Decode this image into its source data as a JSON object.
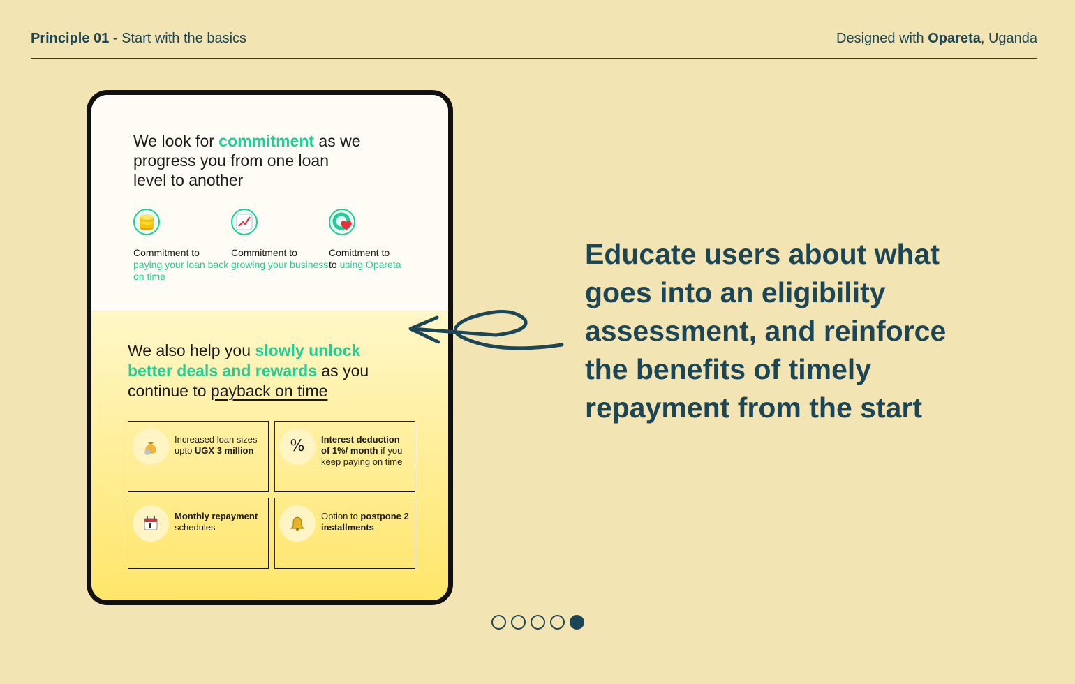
{
  "header": {
    "principle_label": "Principle 01",
    "principle_separator": " - ",
    "principle_title": "Start with the basics",
    "designed_prefix": "Designed with ",
    "designed_brand": "Opareta",
    "designed_suffix": ", Uganda"
  },
  "phone": {
    "headline1": {
      "pre": "We look for ",
      "highlight": "commitment",
      "post": " as we progress you from one loan level to another"
    },
    "pillars": [
      {
        "icon": "coin-stack-icon",
        "title": "Commitment to",
        "detail": "paying your loan back on time"
      },
      {
        "icon": "chart-up-icon",
        "title": "Commitment to",
        "detail": "growing your business"
      },
      {
        "icon": "heart-icon",
        "title": "Comittment to",
        "title_tail": "to",
        "detail": "using Opareta"
      }
    ],
    "headline2": {
      "pre": "We also help you ",
      "highlight": "slowly unlock better deals and rewards",
      "mid": " as you continue to ",
      "underlined": "payback on time"
    },
    "cards": [
      {
        "icon": "money-bag-icon",
        "text1": "Increased loan sizes upto ",
        "bold": "UGX 3 million",
        "text2": ""
      },
      {
        "icon": "percent-icon",
        "bold": "Interest deduction of 1%/ month",
        "text1": "",
        "text2": " if you keep paying on time"
      },
      {
        "icon": "calendar-icon",
        "bold": "Monthly repayment",
        "text1": "",
        "text2": " schedules"
      },
      {
        "icon": "bell-icon",
        "text1": "Option to ",
        "bold": "postpone 2 installments",
        "text2": ""
      }
    ]
  },
  "message": "Educate users about what goes into an eligibility assessment, and reinforce the benefits of timely repayment from the start",
  "pagination": {
    "total": 5,
    "current": 5
  },
  "colors": {
    "background": "#f2e4b3",
    "primary": "#1c4656",
    "accent_green": "#1fcf95",
    "accent_yellow": "#ffe566"
  }
}
